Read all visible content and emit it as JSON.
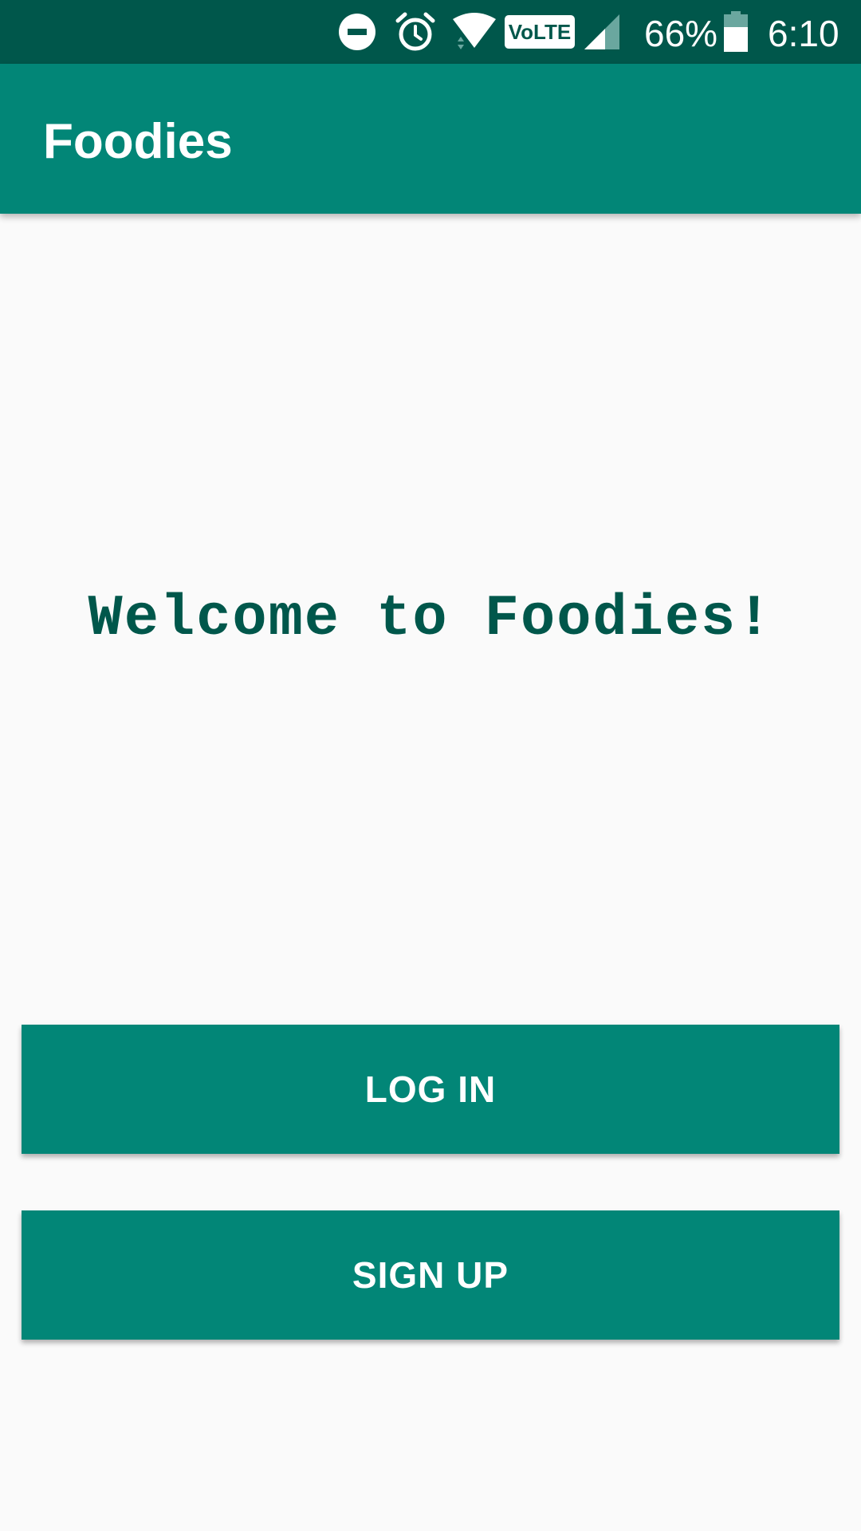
{
  "status_bar": {
    "battery_percent": "66%",
    "time": "6:10",
    "volte_label": "VoLTE",
    "icons": [
      "do-not-disturb-icon",
      "alarm-icon",
      "wifi-icon",
      "volte-icon",
      "signal-icon",
      "battery-icon"
    ],
    "battery_level": 0.66
  },
  "app_bar": {
    "title": "Foodies"
  },
  "main": {
    "welcome_text": "Welcome to Foodies!"
  },
  "buttons": {
    "login_label": "LOG IN",
    "signup_label": "SIGN UP"
  },
  "colors": {
    "status_bar": "#00574b",
    "primary": "#028677",
    "accent_text": "#00574b",
    "background": "#fafafa"
  }
}
